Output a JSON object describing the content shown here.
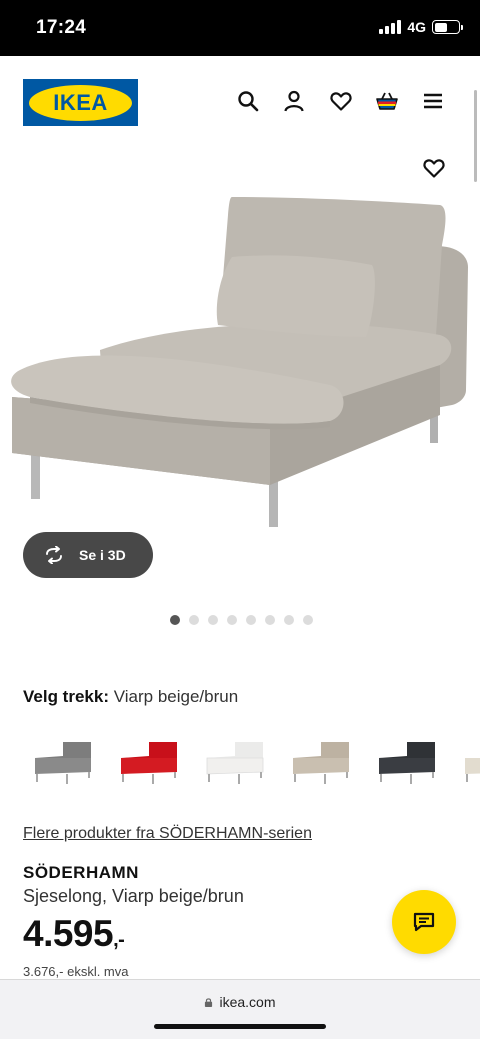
{
  "status_bar": {
    "time": "17:24",
    "network": "4G"
  },
  "header": {
    "logo_text": "IKEA",
    "icons": [
      "search-icon",
      "user-icon",
      "heart-icon",
      "cart-icon",
      "menu-icon"
    ]
  },
  "product": {
    "view_3d_label": "Se i 3D",
    "image_count": 8,
    "active_image": 1,
    "cover_label": "Velg trekk:",
    "cover_value": "Viarp beige/brun",
    "swatches": [
      "grey",
      "red",
      "white",
      "beige",
      "dark-grey",
      "beige-2"
    ],
    "series_link": "Flere produkter fra SÖDERHAMN-serien",
    "name": "SÖDERHAMN",
    "description": "Sjeselong, Viarp beige/brun",
    "price": "4.595",
    "price_suffix": ",-",
    "price_ex_vat": "3.676,- ekskl. mva"
  },
  "browser": {
    "url": "ikea.com"
  },
  "colors": {
    "ikea_blue": "#0058a3",
    "ikea_yellow": "#ffdb00",
    "button_dark": "#484848"
  }
}
